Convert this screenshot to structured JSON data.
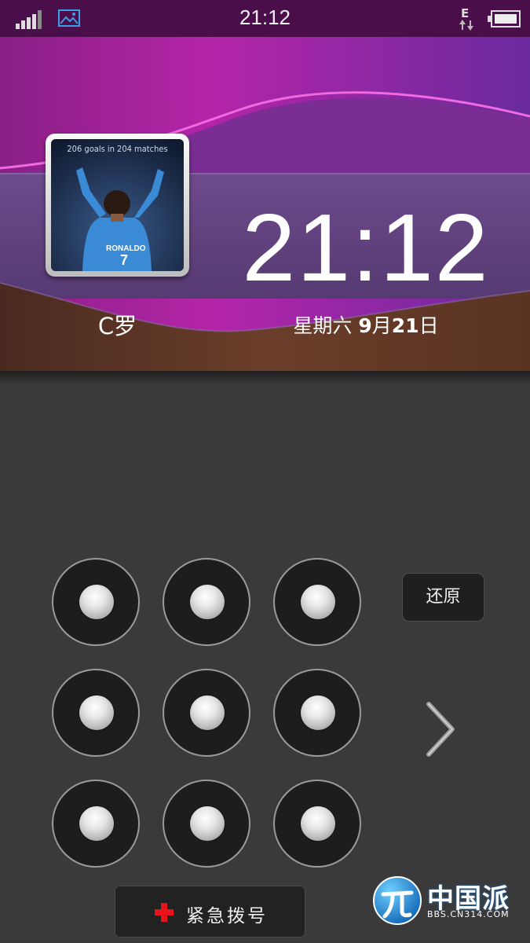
{
  "status_bar": {
    "time": "21:12",
    "signal_icon": "signal-bars-icon",
    "notification_icon": "gallery-icon",
    "network_type": "E",
    "battery_icon": "battery-icon"
  },
  "lockscreen": {
    "photo_caption": "206 goals in 204 matches",
    "jersey_text": "RONALDO",
    "contact_name": "C罗",
    "clock": "21:12",
    "weekday": "星期六",
    "month": "9",
    "day": "21",
    "month_suffix": "月",
    "day_suffix": "日"
  },
  "pattern_lock": {
    "rows": 3,
    "cols": 3,
    "restore_label": "还原",
    "next_icon": "chevron-right-icon"
  },
  "emergency": {
    "label": "紧急拨号",
    "icon": "red-cross-icon",
    "accent_color": "#e8141b"
  },
  "watermark": {
    "title": "中国派",
    "url": "BBS.CN314.COM"
  },
  "colors": {
    "header_magenta": "#c0208f",
    "header_purple": "#5e3a78",
    "header_brown": "#5a3322",
    "background": "#3a3a3a"
  }
}
